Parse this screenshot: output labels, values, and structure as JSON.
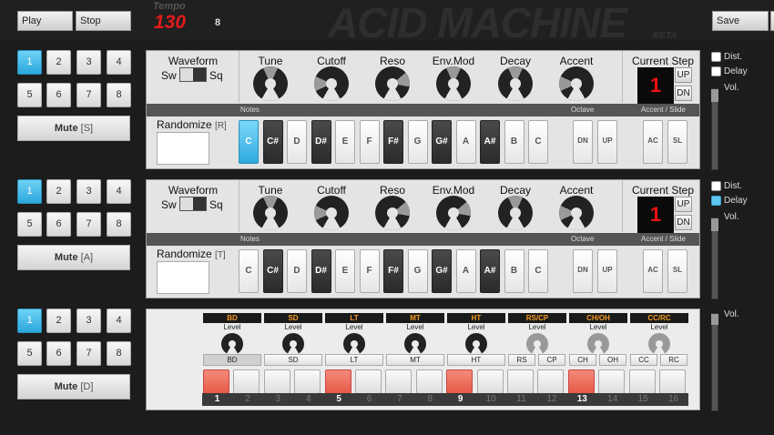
{
  "transport": {
    "play": "Play",
    "stop": "Stop",
    "save": "Save"
  },
  "tempo": {
    "label": "Tempo",
    "value": "130",
    "extra": "8"
  },
  "brand": {
    "title": "ACID MACHINE",
    "beta": "BETA"
  },
  "patterns": [
    "1",
    "2",
    "3",
    "4",
    "5",
    "6",
    "7",
    "8"
  ],
  "synths": [
    {
      "mute": "Mute",
      "mute_key": "[S]",
      "random_key": "[R]",
      "selected_pattern": 0,
      "current_step": "1",
      "delay": false,
      "dist": false,
      "vol": 0.85,
      "knobs": [
        {
          "name": "Tune",
          "value": 0.5
        },
        {
          "name": "Cutoff",
          "value": 0.2
        },
        {
          "name": "Reso",
          "value": 0.75
        },
        {
          "name": "Env.Mod",
          "value": 0.5
        },
        {
          "name": "Decay",
          "value": 0.5
        },
        {
          "name": "Accent",
          "value": 0.2
        }
      ],
      "current_note": "C"
    },
    {
      "mute": "Mute",
      "mute_key": "[A]",
      "random_key": "[T]",
      "selected_pattern": 0,
      "current_step": "1",
      "delay": true,
      "dist": false,
      "vol": 0.85,
      "knobs": [
        {
          "name": "Tune",
          "value": 0.5
        },
        {
          "name": "Cutoff",
          "value": 0.2
        },
        {
          "name": "Reso",
          "value": 0.75
        },
        {
          "name": "Env.Mod",
          "value": 0.75
        },
        {
          "name": "Decay",
          "value": 0.5
        },
        {
          "name": "Accent",
          "value": 0.2
        }
      ],
      "current_note": ""
    }
  ],
  "synth_labels": {
    "waveform": "Waveform",
    "sw": "Sw",
    "sq": "Sq",
    "current_step": "Current Step",
    "up": "UP",
    "dn": "DN",
    "randomize": "Randomize",
    "notes": "Notes",
    "octave": "Octave",
    "accent_slide": "Accent / Slide",
    "ac": "AC",
    "sl": "SL",
    "dist": "Dist.",
    "delay": "Delay",
    "vol": "Vol."
  },
  "notes": [
    "C",
    "C#",
    "D",
    "D#",
    "E",
    "F",
    "F#",
    "G",
    "G#",
    "A",
    "A#",
    "B",
    "C"
  ],
  "drum": {
    "mute": "Mute",
    "mute_key": "[D]",
    "vol_label": "Vol.",
    "level": "Level",
    "selected_pattern": 0,
    "channels": [
      {
        "name": "BD",
        "buttons": [
          "BD"
        ]
      },
      {
        "name": "SD",
        "buttons": [
          "SD"
        ]
      },
      {
        "name": "LT",
        "buttons": [
          "LT"
        ]
      },
      {
        "name": "MT",
        "buttons": [
          "MT"
        ]
      },
      {
        "name": "HT",
        "buttons": [
          "HT"
        ]
      },
      {
        "name": "RS/CP",
        "buttons": [
          "RS",
          "CP"
        ]
      },
      {
        "name": "CH/OH",
        "buttons": [
          "CH",
          "OH"
        ]
      },
      {
        "name": "CC/RC",
        "buttons": [
          "CC",
          "RC"
        ]
      }
    ],
    "active_steps": [
      1,
      5,
      9,
      13
    ],
    "steps": [
      "1",
      "2",
      "3",
      "4",
      "5",
      "6",
      "7",
      "8",
      "9",
      "10",
      "11",
      "12",
      "13",
      "14",
      "15",
      "16"
    ]
  },
  "colors": {
    "accent_blue": "#2aa7dc",
    "tempo_red": "#e31b1b",
    "step_on": "#e55a48",
    "drum_header": "#f59a23"
  }
}
